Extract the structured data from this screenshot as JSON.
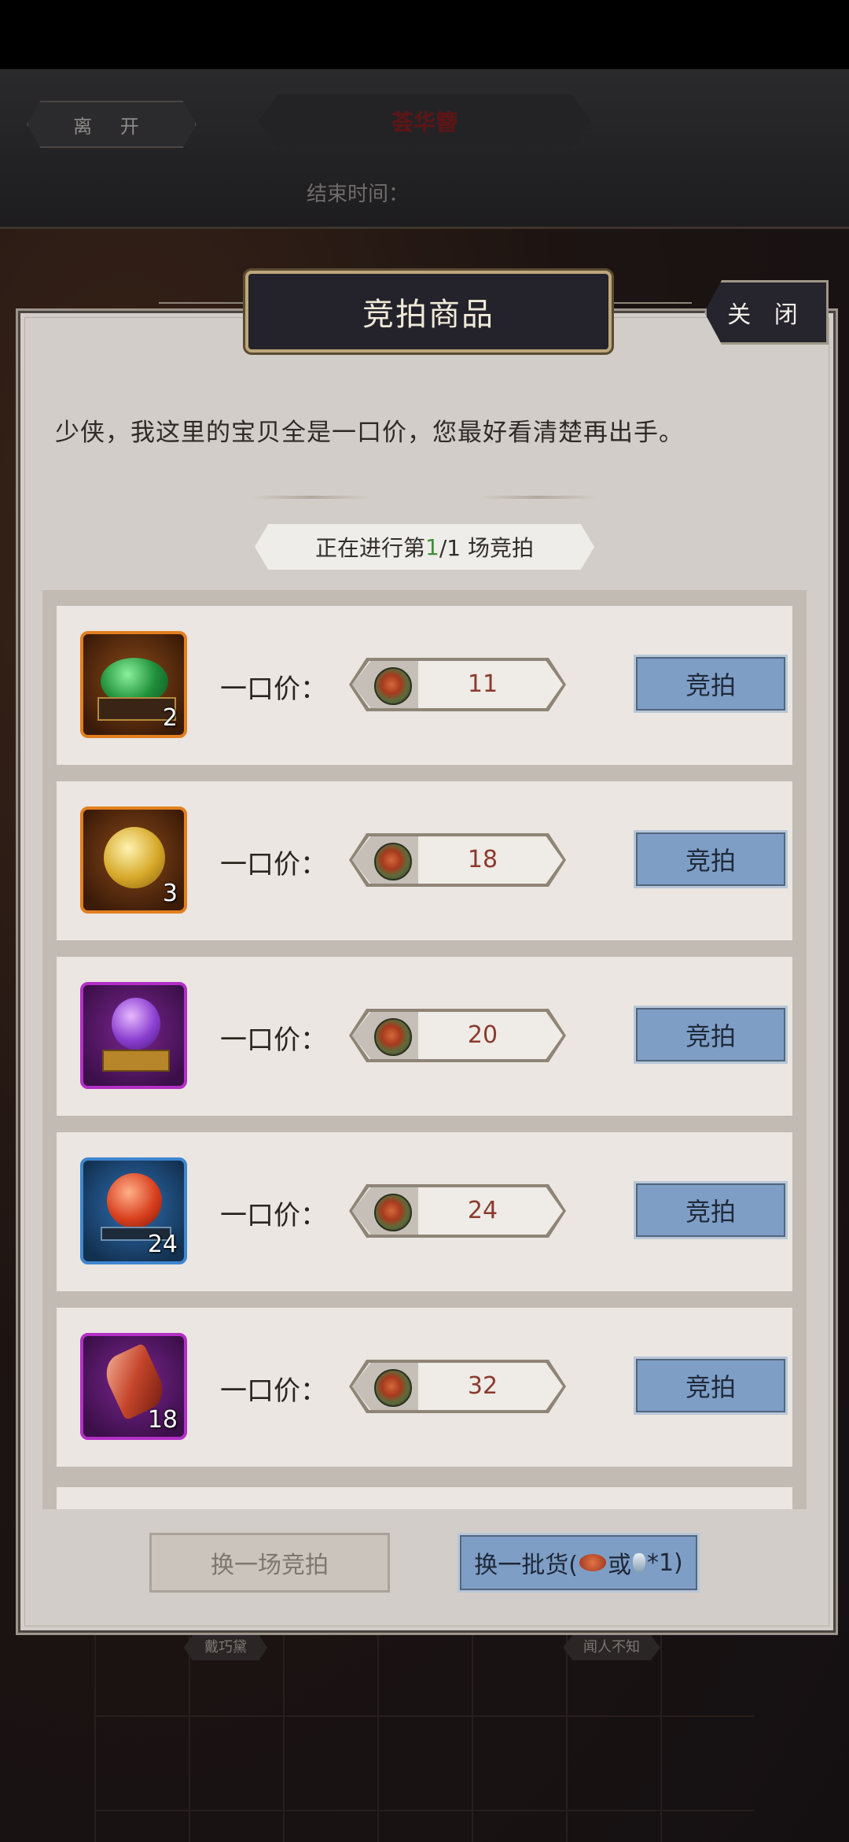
{
  "header": {
    "leave_label": "离 开",
    "title": "荟华簪",
    "end_time_label": "结束时间："
  },
  "dialog": {
    "title": "竞拍商品",
    "close_label": "关 闭",
    "intro": "少侠，我这里的宝贝全是一口价，您最好看清楚再出手。",
    "round_prefix": "正在进行第 ",
    "round_current": "1",
    "round_suffix": "/1 场竞拍",
    "price_label": "一口价：",
    "bid_label": "竞拍",
    "items": [
      {
        "quantity": "2",
        "price": "11",
        "frame_color": "#e27f1f",
        "art": "green-orb-on-stand"
      },
      {
        "quantity": "3",
        "price": "18",
        "frame_color": "#e27f1f",
        "art": "golden-pearl"
      },
      {
        "quantity": "",
        "price": "20",
        "frame_color": "#b32fc6",
        "art": "purple-gem-on-pedestal"
      },
      {
        "quantity": "24",
        "price": "24",
        "frame_color": "#3f86cf",
        "art": "red-orb-on-stand"
      },
      {
        "quantity": "18",
        "price": "32",
        "frame_color": "#b32fc6",
        "art": "red-crystal-shard"
      }
    ],
    "change_round_label": "换一场竞拍",
    "refresh_prefix": "换一批货(",
    "refresh_or": "或",
    "refresh_suffix": "*1)"
  },
  "scene_tags": [
    "戴巧黛",
    "闻人不知"
  ]
}
